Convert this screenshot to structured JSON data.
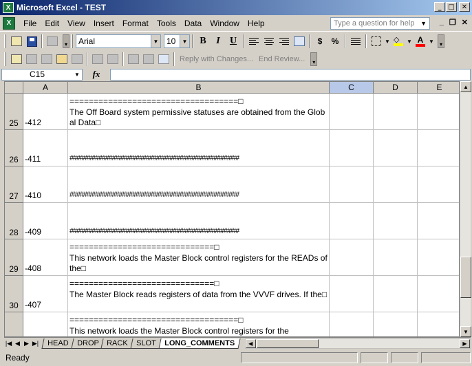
{
  "window": {
    "title": "Microsoft Excel - TEST",
    "app_icon": "X"
  },
  "menu": {
    "items": [
      "File",
      "Edit",
      "View",
      "Insert",
      "Format",
      "Tools",
      "Data",
      "Window",
      "Help"
    ],
    "help_placeholder": "Type a question for help"
  },
  "formatting": {
    "font": "Arial",
    "size": "10",
    "bold": "B",
    "italic": "I",
    "underline": "U",
    "currency": "$",
    "percent": "%"
  },
  "reviewing": {
    "reply": "Reply with Changes...",
    "end_review": "End Review..."
  },
  "formula_bar": {
    "name_box": "C15",
    "fx": "fx",
    "value": ""
  },
  "columns": [
    "A",
    "B",
    "C",
    "D",
    "E"
  ],
  "active_column": "C",
  "rows": [
    {
      "num": "25",
      "a": "-412",
      "b": "===================================□\nThe Off Board system permissive statuses are obtained from the Global Data□",
      "hash": false
    },
    {
      "num": "26",
      "a": "-411",
      "b": "##################################################",
      "hash": true
    },
    {
      "num": "27",
      "a": "-410",
      "b": "##################################################",
      "hash": true
    },
    {
      "num": "28",
      "a": "-409",
      "b": "##################################################",
      "hash": true
    },
    {
      "num": "29",
      "a": "-408",
      "b": "==============================□\nThis network loads the Master Block control registers for the READs of the□",
      "hash": false
    },
    {
      "num": "30",
      "a": "-407",
      "b": "==============================□\nThe Master Block reads registers of data from the VVVF drives. If the□",
      "hash": false
    },
    {
      "num": "",
      "a": "",
      "b": "===================================□\nThis network loads the Master Block control registers for the",
      "hash": false
    }
  ],
  "sheets": [
    "HEAD",
    "DROP",
    "RACK",
    "SLOT",
    "LONG_COMMENTS"
  ],
  "active_sheet": "LONG_COMMENTS",
  "status": "Ready"
}
